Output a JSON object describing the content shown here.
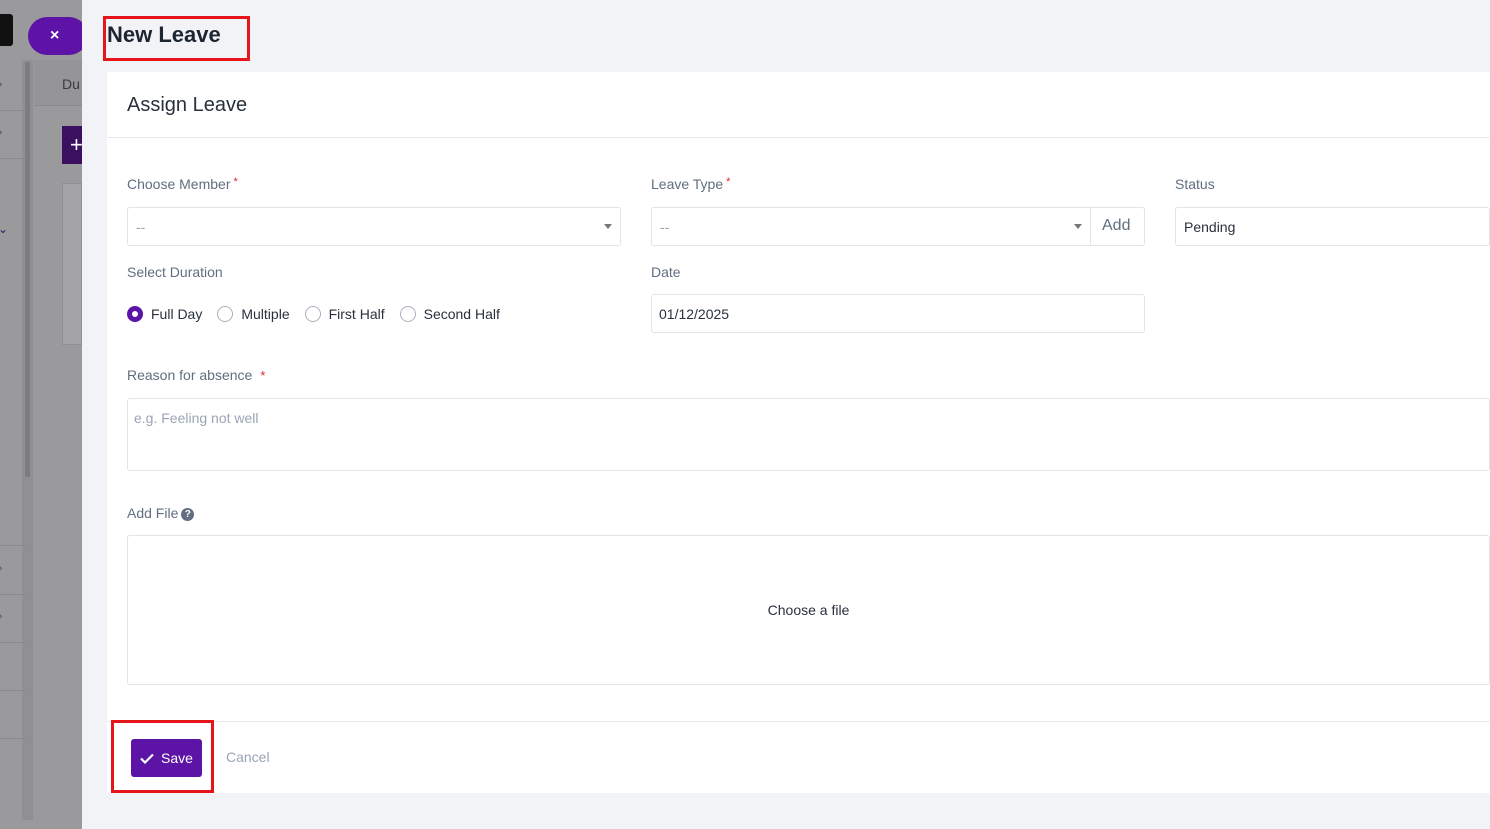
{
  "background": {
    "close_label": "×",
    "tab_text": "Du",
    "plus_label": "+"
  },
  "page": {
    "title": "New Leave"
  },
  "card": {
    "title": "Assign Leave"
  },
  "form": {
    "member": {
      "label": "Choose Member",
      "required": "*",
      "value": "--"
    },
    "leave_type": {
      "label": "Leave Type",
      "required": "*",
      "value": "--",
      "add_label": "Add"
    },
    "status": {
      "label": "Status",
      "value": "Pending"
    },
    "duration": {
      "label": "Select Duration",
      "options": [
        "Full Day",
        "Multiple",
        "First Half",
        "Second Half"
      ],
      "selected": "Full Day"
    },
    "date": {
      "label": "Date",
      "value": "01/12/2025"
    },
    "reason": {
      "label": "Reason for absence",
      "required": "*",
      "placeholder": "e.g. Feeling not well"
    },
    "file": {
      "label": "Add File",
      "help": "?",
      "dropzone_text": "Choose a file"
    }
  },
  "actions": {
    "save_label": "Save",
    "cancel_label": "Cancel"
  },
  "colors": {
    "accent": "#5c13a6",
    "highlight": "#e6141b",
    "required": "#e3242b"
  }
}
